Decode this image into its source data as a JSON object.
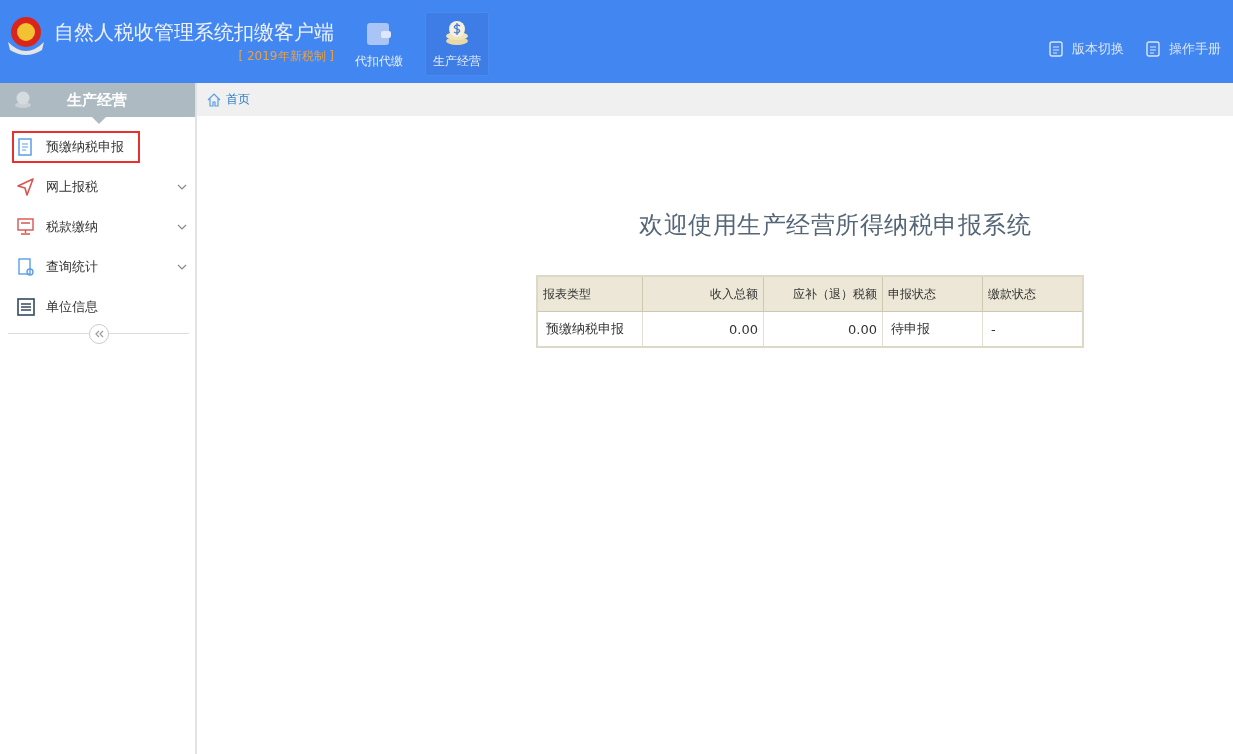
{
  "header": {
    "title": "自然人税收管理系统扣缴客户端",
    "subtitle": "[ 2019年新税制 ]",
    "modules": [
      {
        "label": "代扣代缴",
        "kind": "wallet",
        "selected": false
      },
      {
        "label": "生产经营",
        "kind": "coins",
        "selected": true
      }
    ],
    "links": [
      {
        "label": "版本切换"
      },
      {
        "label": "操作手册"
      }
    ]
  },
  "sidebar": {
    "title": "生产经营",
    "items": [
      {
        "label": "预缴纳税申报",
        "kind": "form",
        "expandable": false,
        "highlighted": true
      },
      {
        "label": "网上报税",
        "kind": "send",
        "expandable": true,
        "highlighted": false
      },
      {
        "label": "税款缴纳",
        "kind": "monitor",
        "expandable": true,
        "highlighted": false
      },
      {
        "label": "查询统计",
        "kind": "lookup",
        "expandable": true,
        "highlighted": false
      },
      {
        "label": "单位信息",
        "kind": "list",
        "expandable": false,
        "highlighted": false
      }
    ]
  },
  "breadcrumb": "首页",
  "welcome": "欢迎使用生产经营所得纳税申报系统",
  "table": {
    "columns": [
      "报表类型",
      "收入总额",
      "应补（退）税额",
      "申报状态",
      "缴款状态"
    ],
    "rows": [
      [
        "预缴纳税申报",
        "0.00",
        "0.00",
        "待申报",
        "-"
      ]
    ]
  }
}
